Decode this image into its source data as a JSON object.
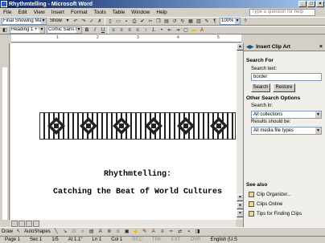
{
  "window": {
    "title": "Rhythmtelling - Microsoft Word"
  },
  "menu": [
    "File",
    "Edit",
    "View",
    "Insert",
    "Format",
    "Tools",
    "Table",
    "Window",
    "Help"
  ],
  "ask_box": "Type a question for help",
  "reviewing": {
    "view": "Final Showing Markup",
    "show": "Show"
  },
  "zoom": "100%",
  "formatting": {
    "style": "Heading 1 + Cc",
    "font": "Comic Sans MS"
  },
  "document": {
    "title": "Rhythmtelling:",
    "subtitle": "Catching the Beat of World Cultures",
    "ruler_marks": [
      "1",
      "2",
      "3",
      "4",
      "5"
    ]
  },
  "task_pane": {
    "title": "Insert Clip Art",
    "search_for": "Search For",
    "search_text_label": "Search text:",
    "search_value": "border",
    "search_button": "Search",
    "restore_button": "Restore",
    "other_options": "Other Search Options",
    "search_in_label": "Search in:",
    "search_in_value": "All collections",
    "results_label": "Results should be:",
    "results_value": "All media file types",
    "see_also": "See also",
    "links": [
      "Clip Organizer...",
      "Clips Online",
      "Tips for Finding Clips"
    ]
  },
  "drawing": {
    "draw": "Draw",
    "autoshapes": "AutoShapes"
  },
  "status": {
    "page": "Page 1",
    "sec": "Sec 1",
    "pages": "1/5",
    "at": "At 1.1\"",
    "ln": "Ln 1",
    "col": "Col 1",
    "rec": "REC",
    "trk": "TRK",
    "ext": "EXT",
    "ovr": "OVR",
    "lang": "English (U.S"
  }
}
